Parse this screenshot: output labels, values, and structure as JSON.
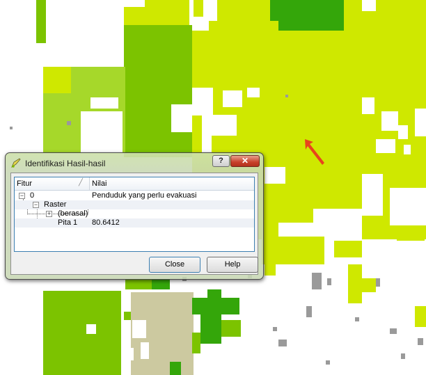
{
  "colors": {
    "lime": "#cfe800",
    "mid_green": "#7cc300",
    "light_green": "#a6d82a",
    "dark_green": "#34a60a",
    "khaki": "#ccc9a0",
    "gray": "#9a9a9a",
    "arrow": "#e8451c"
  },
  "map": {
    "cursor_icon": "arrow-cursor-icon"
  },
  "dialog": {
    "title": "Identifikasi Hasil-hasil",
    "title_icon": "identify-icon",
    "help_glyph": "?",
    "close_glyph": "✕",
    "columns": {
      "fitur": "Fitur",
      "nilai": "Nilai"
    },
    "rows": [
      {
        "fitur": "0",
        "nilai": "Penduduk yang perlu evakuasi"
      },
      {
        "fitur": "Raster",
        "nilai": ""
      },
      {
        "fitur": "(berasal)",
        "nilai": ""
      },
      {
        "fitur": "Pita 1",
        "nilai": "80.6412"
      }
    ],
    "buttons": {
      "close": "Close",
      "help": "Help"
    }
  }
}
